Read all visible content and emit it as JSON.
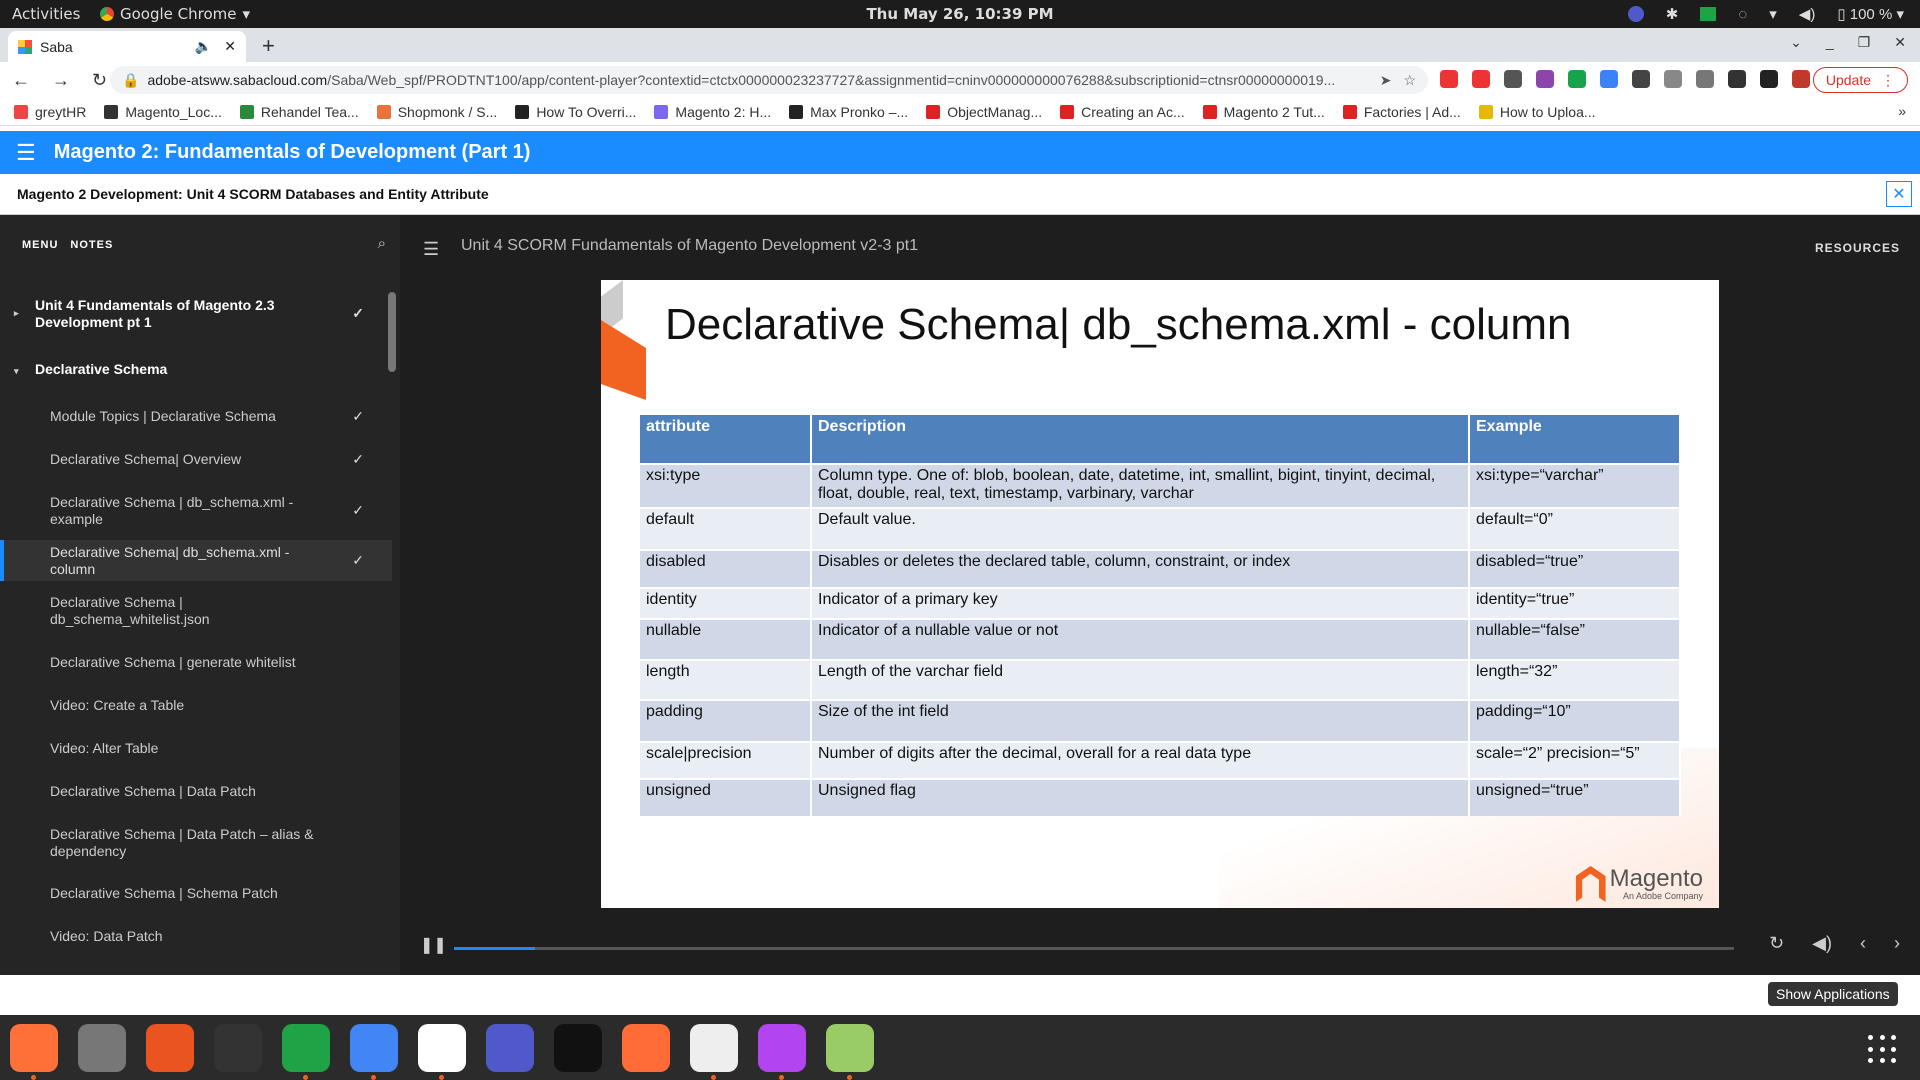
{
  "system": {
    "activities": "Activities",
    "app_name": "Google Chrome",
    "clock": "Thu May 26, 10:39 PM",
    "battery": "100 %",
    "show_applications": "Show Applications"
  },
  "browser": {
    "tab_title": "Saba",
    "url_host": "adobe-atsww.sabacloud.com",
    "url_path": "/Saba/Web_spf/PRODTNT100/app/content-player?contextid=ctctx000000023237727&assignmentid=cninv000000000076288&subscriptionid=ctnsr00000000019...",
    "update_label": "Update",
    "bookmarks": [
      "greytHR",
      "Magento_Loc...",
      "Rehandel Tea...",
      "Shopmonk / S...",
      "How To Overri...",
      "Magento 2: H...",
      "Max Pronko –...",
      "ObjectManag...",
      "Creating an Ac...",
      "Magento 2 Tut...",
      "Factories | Ad...",
      "How to Uploa..."
    ],
    "bookmark_colors": [
      "#e44",
      "#333",
      "#2a8a3a",
      "#e8743b",
      "#222",
      "#7b68ee",
      "#222",
      "#d22",
      "#d22",
      "#d22",
      "#d22",
      "#e6b800"
    ],
    "extension_colors": [
      "#e33",
      "#e33",
      "#555",
      "#8e44ad",
      "#16a34a",
      "#3b82f6",
      "#444",
      "#888",
      "#777",
      "#333",
      "#222",
      "#c0392b"
    ]
  },
  "course": {
    "title": "Magento 2: Fundamentals of Development (Part 1)",
    "subtitle": "Magento 2 Development: Unit 4 SCORM Databases and Entity Attribute"
  },
  "sidebar": {
    "menu_tab": "MENU",
    "notes_tab": "NOTES",
    "sections": [
      {
        "label": "Unit 4 Fundamentals of Magento 2.3 Development pt 1",
        "check": "✓",
        "arrow": "▸"
      },
      {
        "label": "Declarative Schema",
        "arrow": "▾"
      }
    ],
    "items": [
      {
        "label": "Module Topics | Declarative Schema",
        "check": "✓"
      },
      {
        "label": "Declarative Schema| Overview",
        "check": "✓"
      },
      {
        "label": "Declarative Schema | db_schema.xml - example",
        "check": "✓"
      },
      {
        "label": "Declarative Schema| db_schema.xml - column",
        "check": "✓"
      },
      {
        "label": "Declarative Schema | db_schema_whitelist.json"
      },
      {
        "label": "Declarative Schema | generate whitelist"
      },
      {
        "label": "Video: Create a Table"
      },
      {
        "label": "Video: Alter Table"
      },
      {
        "label": "Declarative Schema | Data Patch"
      },
      {
        "label": "Declarative Schema | Data Patch – alias & dependency"
      },
      {
        "label": "Declarative Schema | Schema Patch"
      },
      {
        "label": "Video: Data Patch"
      }
    ]
  },
  "player": {
    "title": "Unit 4 SCORM Fundamentals of Magento Development v2-3 pt1",
    "resources": "RESOURCES",
    "progress": 0.063
  },
  "slide": {
    "title": "Declarative Schema| db_schema.xml - column",
    "headers": [
      "attribute",
      "Description",
      "Example"
    ],
    "rows": [
      [
        "xsi:type",
        "Column type. One of: blob, boolean, date, datetime, int, smallint, bigint, tinyint, decimal, float, double, real, text, timestamp, varbinary, varchar",
        "xsi:type=“varchar”"
      ],
      [
        "default",
        "Default value.",
        "default=“0”"
      ],
      [
        "disabled",
        "Disables or deletes the declared table, column, constraint, or index",
        "disabled=“true”"
      ],
      [
        "identity",
        "Indicator of a primary key",
        "identity=“true”"
      ],
      [
        "nullable",
        "Indicator of a nullable value or not",
        "nullable=“false”"
      ],
      [
        "length",
        "Length of the varchar field",
        "length=“32”"
      ],
      [
        "padding",
        "Size of the int field",
        "padding=“10”"
      ],
      [
        "scale|precision",
        "Number of digits after the decimal, overall for a real data type",
        "scale=“2” precision=“5”"
      ],
      [
        "unsigned",
        "Unsigned flag",
        "unsigned=“true”"
      ]
    ],
    "logo_text": "Magento",
    "logo_sub": "An Adobe Company"
  },
  "dock": {
    "apps": [
      {
        "name": "firefox-icon",
        "color": "#ff7139",
        "running": true
      },
      {
        "name": "files-icon",
        "color": "#777",
        "running": false
      },
      {
        "name": "software-icon",
        "color": "#e95420",
        "running": false
      },
      {
        "name": "terminal-icon",
        "color": "#333",
        "running": false
      },
      {
        "name": "chat-icon",
        "color": "#1ea446",
        "running": true
      },
      {
        "name": "chrome-icon",
        "color": "#4285f4",
        "running": true
      },
      {
        "name": "slack-icon",
        "color": "#fff",
        "running": true
      },
      {
        "name": "teams-icon",
        "color": "#5059c9",
        "running": false
      },
      {
        "name": "camera-icon",
        "color": "#111",
        "running": false
      },
      {
        "name": "postman-icon",
        "color": "#ff6c37",
        "running": false
      },
      {
        "name": "editor-icon",
        "color": "#eee",
        "running": true
      },
      {
        "name": "phpstorm-icon",
        "color": "#b345f1",
        "running": true
      },
      {
        "name": "viewer-icon",
        "color": "#9c6",
        "running": true
      }
    ]
  }
}
